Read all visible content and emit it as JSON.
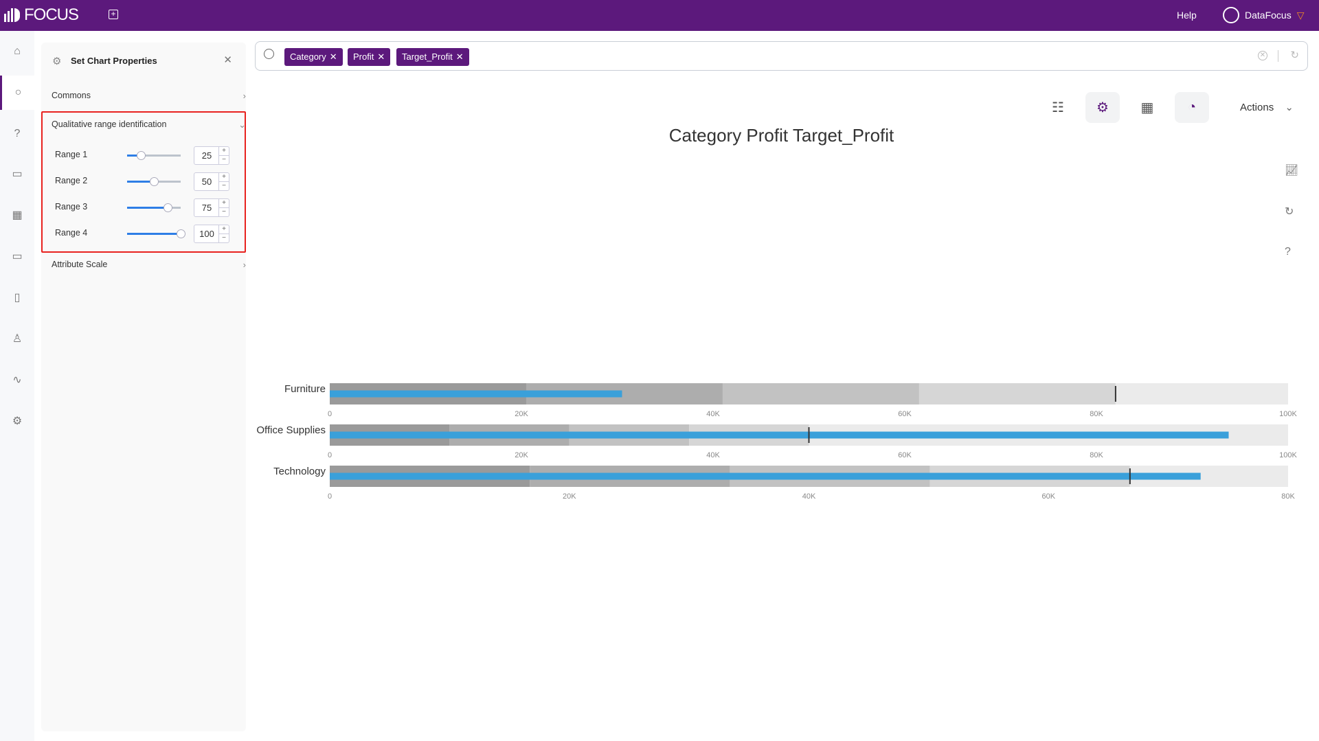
{
  "app": {
    "logo": "FOCUS",
    "help": "Help",
    "user": "DataFocus"
  },
  "nav": [
    "home-icon",
    "search-icon",
    "help-icon",
    "presentation-icon",
    "table-icon",
    "folder-icon",
    "clipboard-icon",
    "user-icon",
    "pulse-icon",
    "settings-icon"
  ],
  "panel": {
    "title": "Set Chart Properties",
    "sections": {
      "commons": "Commons",
      "qualitative": "Qualitative range identification",
      "attribute": "Attribute Scale"
    },
    "ranges": [
      {
        "label": "Range 1",
        "value": 25
      },
      {
        "label": "Range 2",
        "value": 50
      },
      {
        "label": "Range 3",
        "value": 75
      },
      {
        "label": "Range 4",
        "value": 100
      }
    ]
  },
  "search": {
    "chips": [
      "Category",
      "Profit",
      "Target_Profit"
    ]
  },
  "toolbar": {
    "actions": "Actions"
  },
  "colors": {
    "brand": "#5c197c",
    "bar": "#3aa0da",
    "highlight": "#e8211e"
  },
  "chart_data": {
    "type": "bullet",
    "title": "Category Profit Target_Profit",
    "band_percents": [
      25,
      50,
      75,
      100
    ],
    "rows": [
      {
        "category": "Furniture",
        "profit": 30500,
        "target": 82000,
        "xlim": [
          0,
          100000
        ],
        "ticks": [
          "0",
          "20K",
          "40K",
          "60K",
          "80K",
          "100K"
        ]
      },
      {
        "category": "Office Supplies",
        "profit": 93800,
        "target": 50000,
        "xlim": [
          0,
          100000
        ],
        "ticks": [
          "0",
          "20K",
          "40K",
          "60K",
          "80K",
          "100K"
        ]
      },
      {
        "category": "Technology",
        "profit": 72700,
        "target": 66800,
        "xlim": [
          0,
          80000
        ],
        "ticks": [
          "0",
          "20K",
          "40K",
          "60K",
          "80K"
        ]
      }
    ]
  }
}
